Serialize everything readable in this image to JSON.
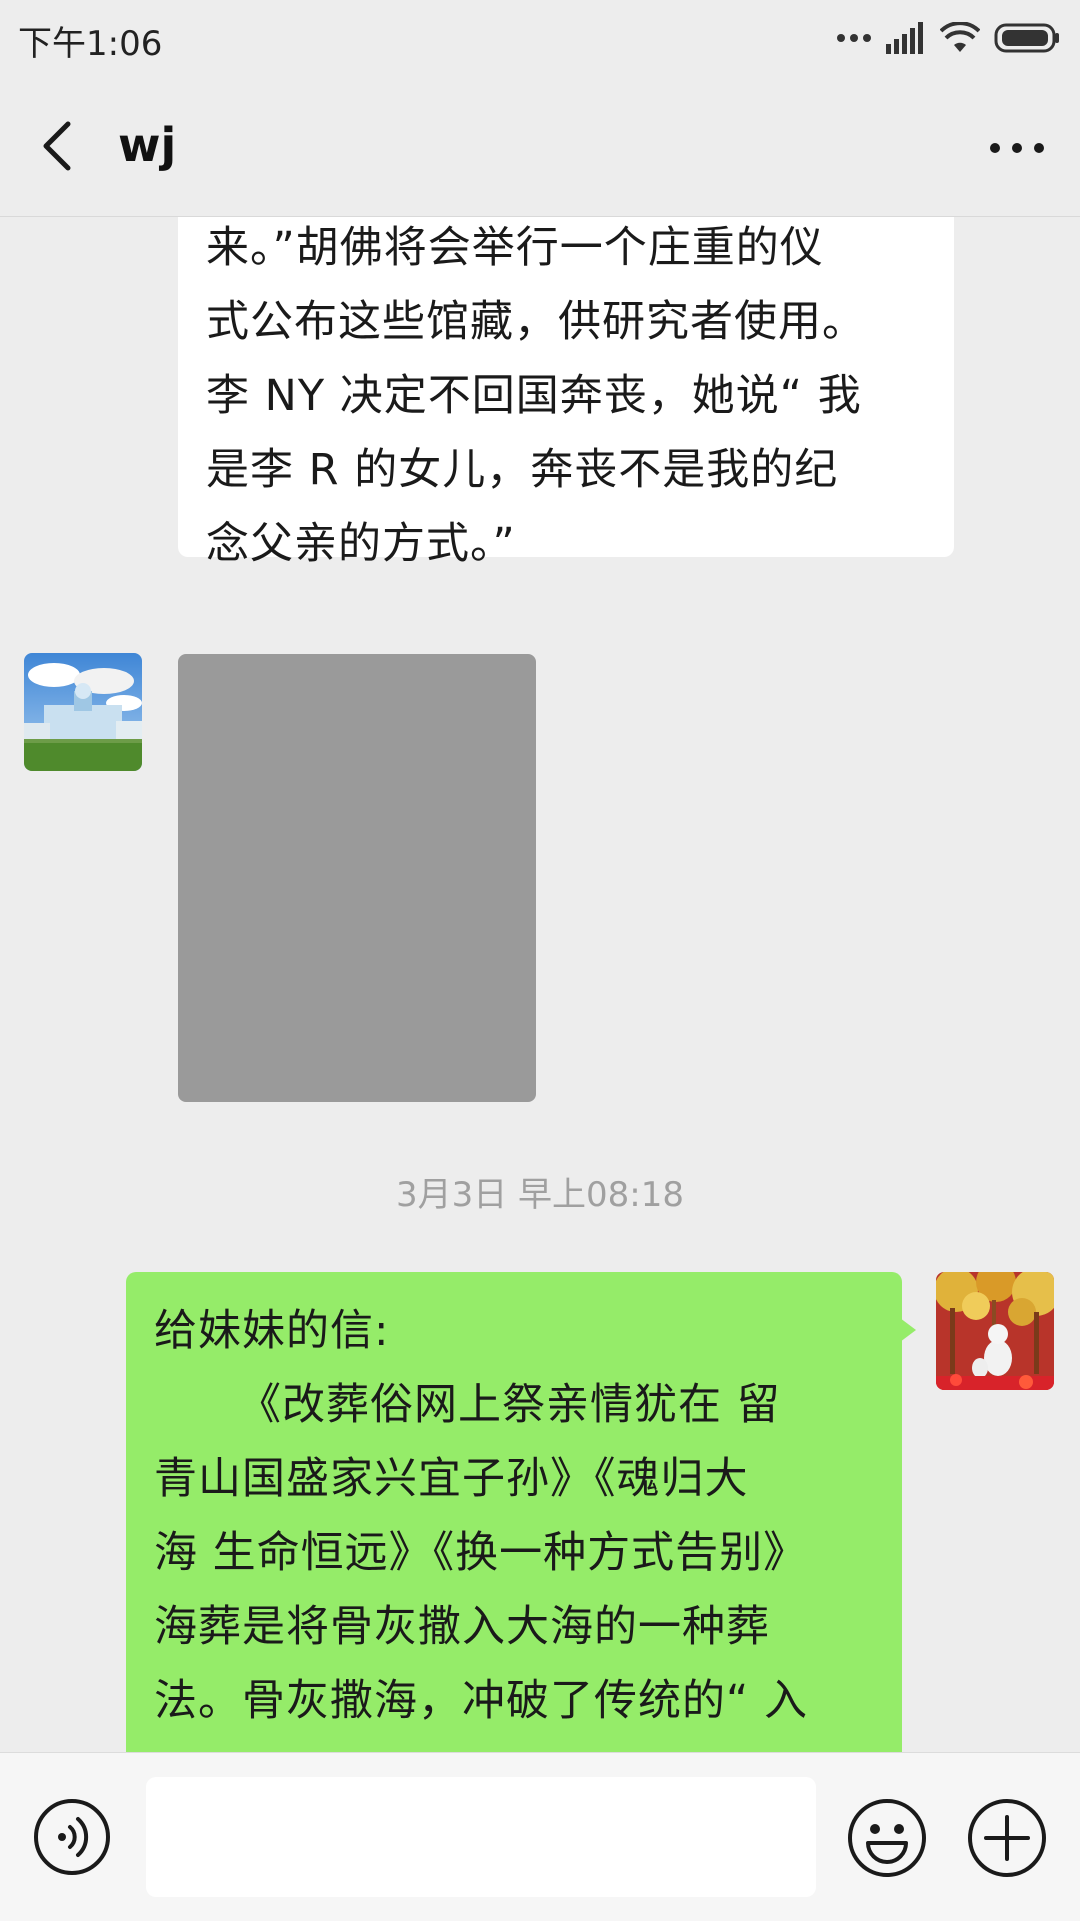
{
  "status_bar": {
    "time": "下午1:06",
    "icons": [
      "dots-icon",
      "signal-icon",
      "wifi-icon",
      "battery-icon"
    ]
  },
  "header": {
    "title": "wj",
    "icons": {
      "back": "chevron-left-icon",
      "more": "more-dots-icon"
    }
  },
  "messages": [
    {
      "direction": "incoming",
      "type": "text",
      "lines": [
        "来。”胡佛将会举行一个庄重的仪",
        "式公布这些馆藏，供研究者使用。",
        "李 NY 决定不回国奔丧，她说“ 我",
        "是李 R 的女儿，奔丧不是我的纪",
        "念父亲的方式。”"
      ]
    },
    {
      "direction": "incoming",
      "type": "image"
    },
    {
      "type": "timestamp",
      "text": "3月3日 早上08:18"
    },
    {
      "direction": "outgoing",
      "type": "text",
      "lines": [
        "给妹妹的信:",
        "《改葬俗网上祭亲情犹在  留",
        "青山国盛家兴宜子孙》《魂归大",
        "海  生命恒远》《换一种方式告别》",
        "海葬是将骨灰撒入大海的一种葬",
        "法。骨灰撒海，冲破了传统的“ 入"
      ]
    }
  ],
  "colors": {
    "background": "#ededed",
    "incoming_bubble": "#ffffff",
    "outgoing_bubble": "#95ec69",
    "timestamp": "#a0a0a0"
  },
  "input_bar": {
    "value": "",
    "placeholder": "",
    "icons": [
      "voice-icon",
      "emoji-icon",
      "plus-icon"
    ]
  }
}
